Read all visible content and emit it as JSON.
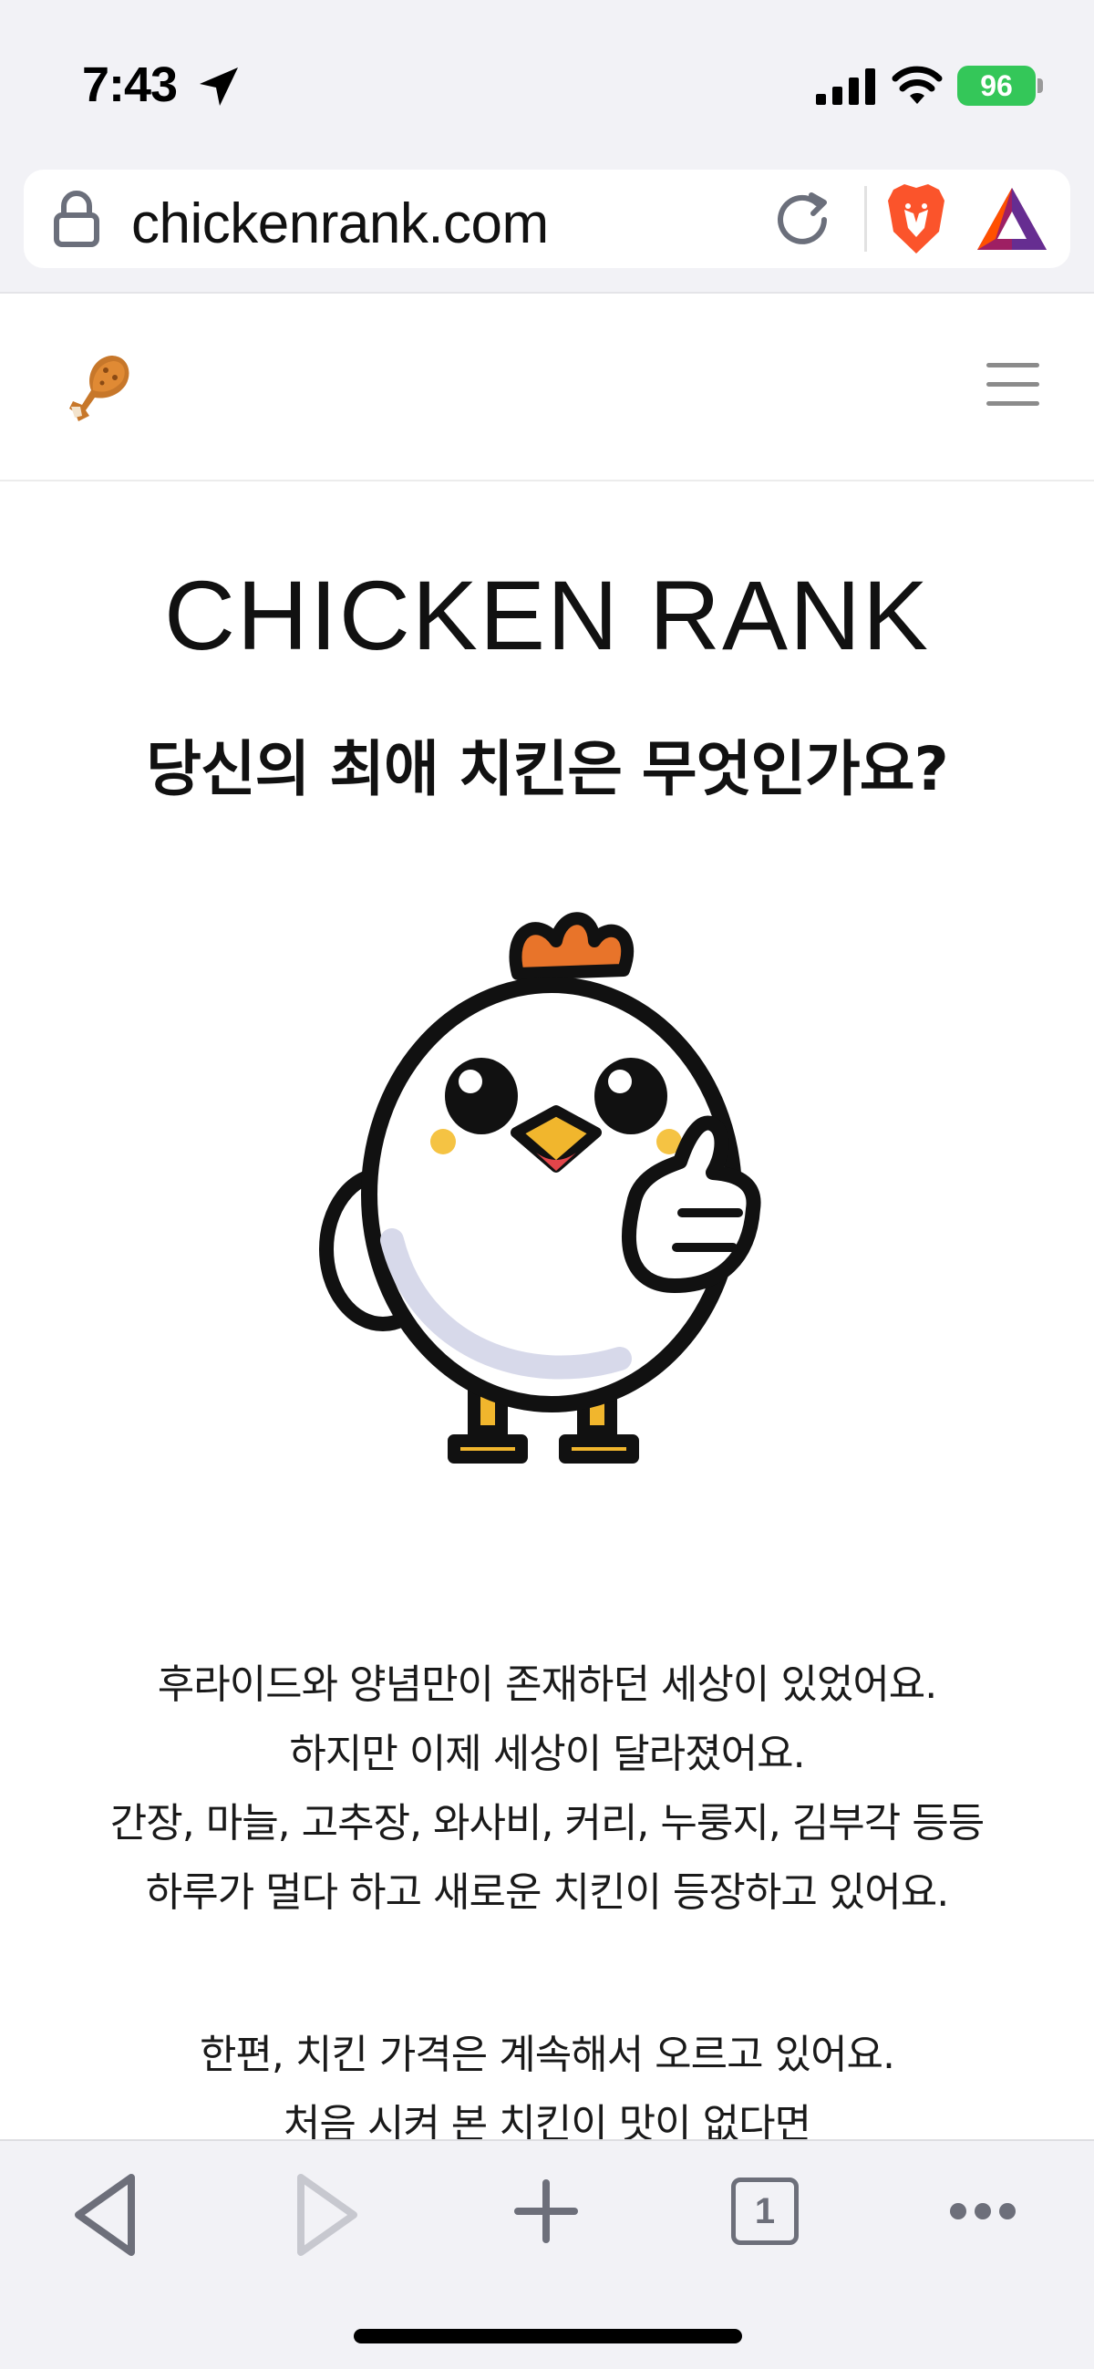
{
  "status_bar": {
    "time": "7:43",
    "battery": "96"
  },
  "browser": {
    "url": "chickenrank.com",
    "tab_count": "1"
  },
  "site": {
    "title": "CHICKEN RANK",
    "subtitle": "당신의 최애 치킨은 무엇인가요?",
    "intro_lines": [
      "후라이드와 양념만이 존재하던 세상이 있었어요.",
      "하지만 이제 세상이 달라졌어요.",
      "간장, 마늘, 고추장, 와사비, 커리, 누룽지, 김부각 등등",
      "하루가 멀다 하고 새로운 치킨이 등장하고 있어요."
    ],
    "second_lines": [
      "한편, 치킨 가격은 계속해서 오르고 있어요.",
      "처음 시켜 본 치킨이 맛이 없다면"
    ]
  },
  "colors": {
    "battery_green": "#34c759",
    "brave_orange": "#fb542b",
    "toolbar_gray": "#6d6f7a"
  },
  "icons": [
    "location-arrow-icon",
    "signal-icon",
    "wifi-icon",
    "lock-icon",
    "reload-icon",
    "brave-lion-icon",
    "bat-token-icon",
    "drumstick-logo-icon",
    "hamburger-menu-icon",
    "back-arrow-icon",
    "forward-arrow-icon",
    "new-tab-plus-icon",
    "tabs-count-icon",
    "more-dots-icon"
  ]
}
